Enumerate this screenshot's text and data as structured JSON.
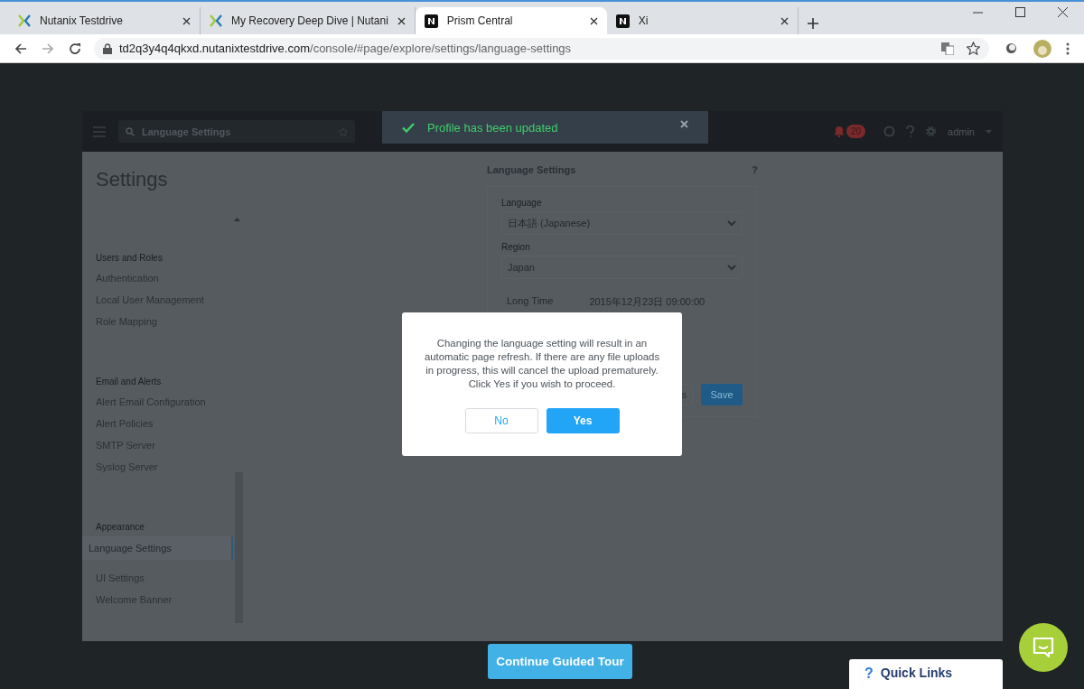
{
  "browser": {
    "tabs": [
      {
        "title": "Nutanix Testdrive",
        "kind": "x",
        "selected": false
      },
      {
        "title": "My Recovery Deep Dive | Nutani",
        "kind": "x",
        "selected": false
      },
      {
        "title": "Prism Central",
        "kind": "n",
        "selected": true
      },
      {
        "title": "Xi",
        "kind": "n",
        "selected": false
      }
    ],
    "url_host": "td2q3y4q4qkxd.nutanixtestdrive.com",
    "url_path": "/console/#page/explore/settings/language-settings"
  },
  "header": {
    "search_value": "Language Settings",
    "alert_count": "20",
    "user": "admin"
  },
  "toast": {
    "message": "Profile has been updated"
  },
  "sidebar": {
    "title": "Settings",
    "groups": [
      {
        "heading": "Users and Roles",
        "items": [
          {
            "label": "Authentication",
            "selected": false
          },
          {
            "label": "Local User Management",
            "selected": false
          },
          {
            "label": "Role Mapping",
            "selected": false
          }
        ]
      },
      {
        "heading": "Email and Alerts",
        "items": [
          {
            "label": "Alert Email Configuration",
            "selected": false
          },
          {
            "label": "Alert Policies",
            "selected": false
          },
          {
            "label": "SMTP Server",
            "selected": false
          },
          {
            "label": "Syslog Server",
            "selected": false
          }
        ]
      },
      {
        "heading": "Appearance",
        "items": [
          {
            "label": "Language Settings",
            "selected": true
          },
          {
            "label": "UI Settings",
            "selected": false
          },
          {
            "label": "Welcome Banner",
            "selected": false
          }
        ]
      }
    ]
  },
  "panel": {
    "title": "Language Settings",
    "help": "?",
    "fields": [
      {
        "label": "Language",
        "value": "日本語 (Japanese)"
      },
      {
        "label": "Region",
        "value": "Japan"
      }
    ],
    "long_time": {
      "label": "Long Time",
      "value": "2015年12月23日 09:00:00"
    },
    "buttons": [
      {
        "label": "s",
        "kind": "secondary"
      },
      {
        "label": "Save",
        "kind": "primary"
      }
    ]
  },
  "dialog": {
    "message": "Changing the language setting will result in an automatic page refresh. If there are any file uploads in progress, this will cancel the upload prematurely. Click Yes if you wish to proceed.",
    "buttons": [
      {
        "label": "No",
        "kind": "secondary"
      },
      {
        "label": "Yes",
        "kind": "primary"
      }
    ]
  },
  "guided_tour": {
    "label": "Continue Guided Tour"
  },
  "quick_links": {
    "icon": "?",
    "label": "Quick Links"
  }
}
